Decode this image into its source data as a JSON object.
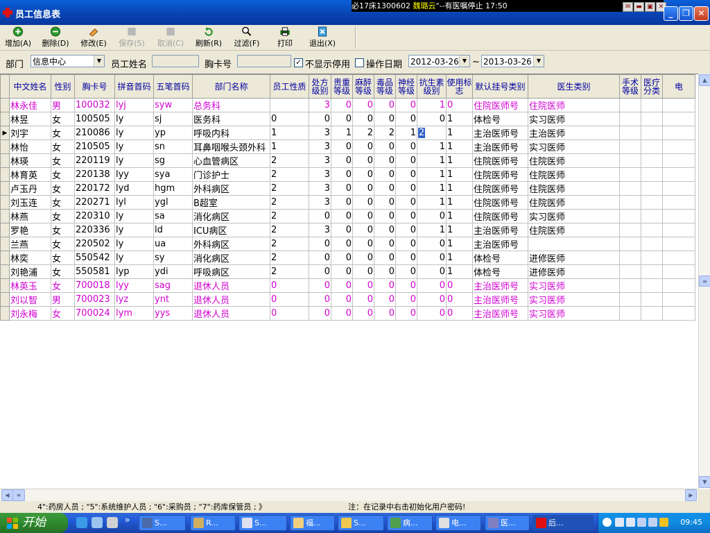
{
  "window": {
    "title": "员工信息表"
  },
  "ticker": {
    "prefix": "必17床1300602 ",
    "name": "魏璐云",
    "message": "\"--有医嘱停止 17:50"
  },
  "toolbar": [
    {
      "label": "增加(A)",
      "icon": "add-icon",
      "disabled": false
    },
    {
      "label": "删除(D)",
      "icon": "delete-icon",
      "disabled": false
    },
    {
      "label": "修改(E)",
      "icon": "edit-icon",
      "disabled": false
    },
    {
      "label": "保存(S)",
      "icon": "save-icon",
      "disabled": true
    },
    {
      "label": "取消(C)",
      "icon": "cancel-icon",
      "disabled": true
    },
    {
      "label": "刷新(R)",
      "icon": "refresh-icon",
      "disabled": false
    },
    {
      "label": "过滤(F)",
      "icon": "filter-icon",
      "disabled": false
    },
    {
      "label": "打印",
      "icon": "printer-icon",
      "disabled": false
    },
    {
      "label": "退出(X)",
      "icon": "exit-icon",
      "disabled": false
    }
  ],
  "filter": {
    "dept_label": "部门",
    "dept_value": "信息中心",
    "name_label": "员工姓名",
    "name_value": "",
    "badge_label": "胸卡号",
    "badge_value": "",
    "hide_disabled_checked": true,
    "hide_disabled_label": "不显示停用",
    "opdate_checked": false,
    "opdate_label": "操作日期",
    "date_from": "2012-03-26",
    "date_sep": "~",
    "date_to": "2013-03-26"
  },
  "table": {
    "columns": [
      "中文姓名",
      "性别",
      "胸卡号",
      "拼音首码",
      "五笔首码",
      "部门名称",
      "员工性质",
      "处方级别",
      "贵重等级",
      "麻醉等级",
      "毒品等级",
      "神经等级",
      "抗生素级别",
      "使用标志",
      "默认挂号类别",
      "医生类别",
      "手术等级",
      "医疗分类",
      "电"
    ],
    "rows": [
      {
        "style": "magenta",
        "current": false,
        "cells": [
          "林永佳",
          "男",
          "100032",
          "lyj",
          "syw",
          "总务科",
          "",
          "3",
          "0",
          "0",
          "0",
          "0",
          "1",
          "0",
          "住院医师号",
          "住院医师",
          "",
          "",
          ""
        ]
      },
      {
        "style": "normal",
        "current": false,
        "cells": [
          "林昱",
          "女",
          "100505",
          "ly",
          "sj",
          "医务科",
          "0",
          "0",
          "0",
          "0",
          "0",
          "0",
          "0",
          "1",
          "体检号",
          "实习医师",
          "",
          "",
          ""
        ]
      },
      {
        "style": "normal",
        "current": true,
        "cells": [
          "刘宇",
          "女",
          "210086",
          "ly",
          "yp",
          "呼吸内科",
          "1",
          "3",
          "1",
          "2",
          "2",
          "1",
          "2",
          "1",
          "主治医师号",
          "主治医师",
          "",
          "",
          ""
        ]
      },
      {
        "style": "normal",
        "current": false,
        "cells": [
          "林怡",
          "女",
          "210505",
          "ly",
          "sn",
          "耳鼻咽喉头颈外科",
          "1",
          "3",
          "0",
          "0",
          "0",
          "0",
          "1",
          "1",
          "主治医师号",
          "实习医师",
          "",
          "",
          ""
        ]
      },
      {
        "style": "normal",
        "current": false,
        "cells": [
          "林瑛",
          "女",
          "220119",
          "ly",
          "sg",
          "心血管病区",
          "2",
          "3",
          "0",
          "0",
          "0",
          "0",
          "1",
          "1",
          "住院医师号",
          "住院医师",
          "",
          "",
          ""
        ]
      },
      {
        "style": "normal",
        "current": false,
        "cells": [
          "林育英",
          "女",
          "220138",
          "lyy",
          "sya",
          "门诊护士",
          "2",
          "3",
          "0",
          "0",
          "0",
          "0",
          "1",
          "1",
          "住院医师号",
          "住院医师",
          "",
          "",
          ""
        ]
      },
      {
        "style": "normal",
        "current": false,
        "cells": [
          "卢玉丹",
          "女",
          "220172",
          "lyd",
          "hgm",
          "外科病区",
          "2",
          "3",
          "0",
          "0",
          "0",
          "0",
          "1",
          "1",
          "住院医师号",
          "住院医师",
          "",
          "",
          ""
        ]
      },
      {
        "style": "normal",
        "current": false,
        "cells": [
          "刘玉连",
          "女",
          "220271",
          "lyl",
          "ygl",
          "B超室",
          "2",
          "3",
          "0",
          "0",
          "0",
          "0",
          "1",
          "1",
          "住院医师号",
          "住院医师",
          "",
          "",
          ""
        ]
      },
      {
        "style": "normal",
        "current": false,
        "cells": [
          "林燕",
          "女",
          "220310",
          "ly",
          "sa",
          "消化病区",
          "2",
          "0",
          "0",
          "0",
          "0",
          "0",
          "0",
          "1",
          "住院医师号",
          "实习医师",
          "",
          "",
          ""
        ]
      },
      {
        "style": "normal",
        "current": false,
        "cells": [
          "罗艳",
          "女",
          "220336",
          "ly",
          "ld",
          "ICU病区",
          "2",
          "3",
          "0",
          "0",
          "0",
          "0",
          "1",
          "1",
          "主治医师号",
          "住院医师",
          "",
          "",
          ""
        ]
      },
      {
        "style": "normal",
        "current": false,
        "cells": [
          "兰燕",
          "女",
          "220502",
          "ly",
          "ua",
          "外科病区",
          "2",
          "0",
          "0",
          "0",
          "0",
          "0",
          "0",
          "1",
          "主治医师号",
          "",
          "",
          "",
          ""
        ]
      },
      {
        "style": "normal",
        "current": false,
        "cells": [
          "林奕",
          "女",
          "550542",
          "ly",
          "sy",
          "消化病区",
          "2",
          "0",
          "0",
          "0",
          "0",
          "0",
          "0",
          "1",
          "体检号",
          "进修医师",
          "",
          "",
          ""
        ]
      },
      {
        "style": "normal",
        "current": false,
        "cells": [
          "刘艳浦",
          "女",
          "550581",
          "lyp",
          "ydi",
          "呼吸病区",
          "2",
          "0",
          "0",
          "0",
          "0",
          "0",
          "0",
          "1",
          "体检号",
          "进修医师",
          "",
          "",
          ""
        ]
      },
      {
        "style": "magenta",
        "current": false,
        "cells": [
          "林英玉",
          "女",
          "700018",
          "lyy",
          "sag",
          "退休人员",
          "0",
          "0",
          "0",
          "0",
          "0",
          "0",
          "0",
          "0",
          "主治医师号",
          "实习医师",
          "",
          "",
          ""
        ]
      },
      {
        "style": "magenta",
        "current": false,
        "cells": [
          "刘以智",
          "男",
          "700023",
          "lyz",
          "ynt",
          "退休人员",
          "0",
          "0",
          "0",
          "0",
          "0",
          "0",
          "0",
          "0",
          "主治医师号",
          "实习医师",
          "",
          "",
          ""
        ]
      },
      {
        "style": "magenta",
        "current": false,
        "cells": [
          "刘永梅",
          "女",
          "700024",
          "lym",
          "yys",
          "退休人员",
          "0",
          "0",
          "0",
          "0",
          "0",
          "0",
          "0",
          "0",
          "主治医师号",
          "实习医师",
          "",
          "",
          ""
        ]
      }
    ]
  },
  "status": {
    "left": "4\":药房人员 ; \"5\":系统维护人员 ; \"6\":采购员 ; \"7\":药库保管员 ; 》",
    "right": "注：在记录中右击初始化用户密码!"
  },
  "taskbar": {
    "start_label": "开始",
    "tasks": [
      "S...",
      "R...",
      "S...",
      "福...",
      "S...",
      "病...",
      "电...",
      "医...",
      "后..."
    ],
    "clock": "09:45"
  },
  "colors": {
    "title_bar": "#0a5fd8",
    "magenta_row": "#d000d0",
    "header_text": "#0000a0",
    "selected_cell": "#3163c6",
    "taskbar": "#245edb",
    "start": "#2f8a2f"
  }
}
